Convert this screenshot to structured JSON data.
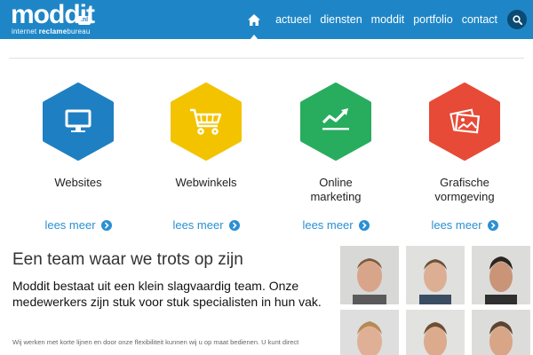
{
  "header": {
    "logo": {
      "main": "moddit",
      "badge": ".nl",
      "sub_light": "internet ",
      "sub_bold": "reclame",
      "sub_tail": "bureau"
    },
    "nav": {
      "home_icon": "home-icon",
      "items": [
        "actueel",
        "diensten",
        "moddit",
        "portfolio",
        "contact"
      ],
      "search_icon": "search-icon"
    },
    "colors": {
      "bar": "#1e86c7",
      "search": "#0b4a72"
    }
  },
  "services": [
    {
      "title_lines": [
        "Websites"
      ],
      "link": "lees meer",
      "icon": "monitor-icon",
      "color": "#1f7fc3"
    },
    {
      "title_lines": [
        "Webwinkels"
      ],
      "link": "lees meer",
      "icon": "shopping-cart-icon",
      "color": "#f3c300"
    },
    {
      "title_lines": [
        "Online",
        "marketing"
      ],
      "link": "lees meer",
      "icon": "trend-chart-icon",
      "color": "#27ad5d"
    },
    {
      "title_lines": [
        "Grafische",
        "vormgeving"
      ],
      "link": "lees meer",
      "icon": "photos-icon",
      "color": "#e74a36"
    }
  ],
  "team": {
    "heading": "Een team waar we trots op zijn",
    "lead": "Moddit bestaat uit een klein slagvaardig team. Onze medewerkers zijn stuk voor stuk specialisten in hun vak.",
    "small": "Wij werken met korte lijnen en door onze flexibiliteit kunnen wij u op maat bedienen. U kunt direct",
    "photos": 6
  },
  "accent_link": "#2b8fd3"
}
